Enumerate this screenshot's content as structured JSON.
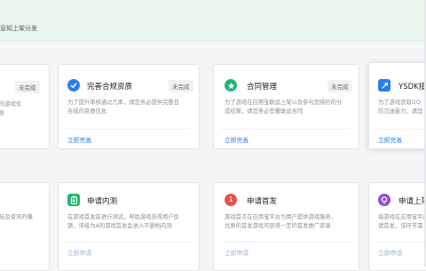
{
  "banner": {
    "text": "息知上架分发"
  },
  "colors": {
    "accent": "#2a7cf0",
    "green": "#22b573",
    "red": "#e5534b",
    "purple": "#8d4fd8",
    "banner_bg": "#e9f7ef"
  },
  "row1": [
    {
      "title": "",
      "badge": "未完成",
      "desc": "的游戏信\n息",
      "link": ""
    },
    {
      "title": "完善合规资质",
      "badge": "未完成",
      "icon": "verified-badge-icon",
      "desc": "为了提升审核通过几率，请您务必提供完整且\n合规的资质信息",
      "link": "立即完善"
    },
    {
      "title": "合同管理",
      "badge": "未完成",
      "icon": "star-circle-icon",
      "desc": "为了游戏在应用宝联运上架以及参与您缔约的分\n成结算，请您务必签署联运合同",
      "link": "立即完善"
    },
    {
      "title": "YSDK接",
      "badge": "",
      "icon": "link-icon",
      "desc": "为了游戏获取QQ\n防沉迷能力，请您",
      "link": "立即完善"
    }
  ],
  "row2": [
    {
      "title": "",
      "badge": "",
      "desc": "坛及资讯的曝\n",
      "link": ""
    },
    {
      "title": "申请内测",
      "badge": "",
      "icon": "battery-icon",
      "desc": "在游戏首发前进行测试，帮助游戏获得用户反\n馈，评级为A的游戏首发会进入不删档内测",
      "link": "立即申请"
    },
    {
      "title": "申请首发",
      "badge": "",
      "icon": "number-one-icon",
      "desc": "游戏首次在应用宝平台为用户提供游戏服务，\n优质的首发游戏可获得一定的首发推广资源",
      "link": "立即申请"
    },
    {
      "title": "申请上架",
      "badge": "",
      "icon": "broadcast-icon",
      "desc": "指游戏在应用宝平台\n请首发，该环节需",
      "link": "立即申请"
    }
  ]
}
